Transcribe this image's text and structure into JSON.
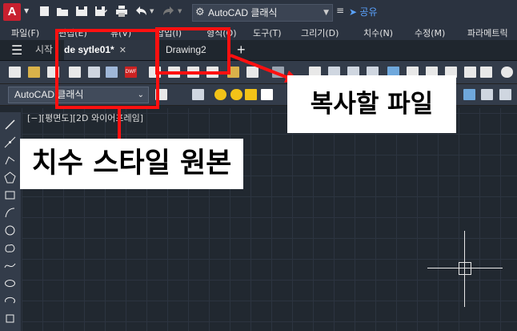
{
  "app": {
    "logo_letter": "A",
    "workspace_selector": "AutoCAD 클래식",
    "share_label": "공유"
  },
  "menu": [
    "파일(F)",
    "편집(E)",
    "뷰(V)",
    "삽입(I)",
    "형식(O)",
    "도구(T)",
    "그리기(D)",
    "치수(N)",
    "수정(M)",
    "파라메트릭"
  ],
  "tabs": {
    "start": "시작",
    "active": "de sytle01*",
    "second": "Drawing2",
    "add": "+"
  },
  "toolbar2": {
    "workspace_dropdown": "AutoCAD 클래식"
  },
  "viewport": {
    "label": "[−][평면도][2D 와이어프레임]"
  },
  "annotations": {
    "copy_target": "복사할 파일",
    "dim_style_source": "치수 스타일 원본"
  },
  "colors": {
    "annotation_red": "#ff1010",
    "autocad_red": "#c8202f",
    "share_blue": "#5aa3ff"
  }
}
